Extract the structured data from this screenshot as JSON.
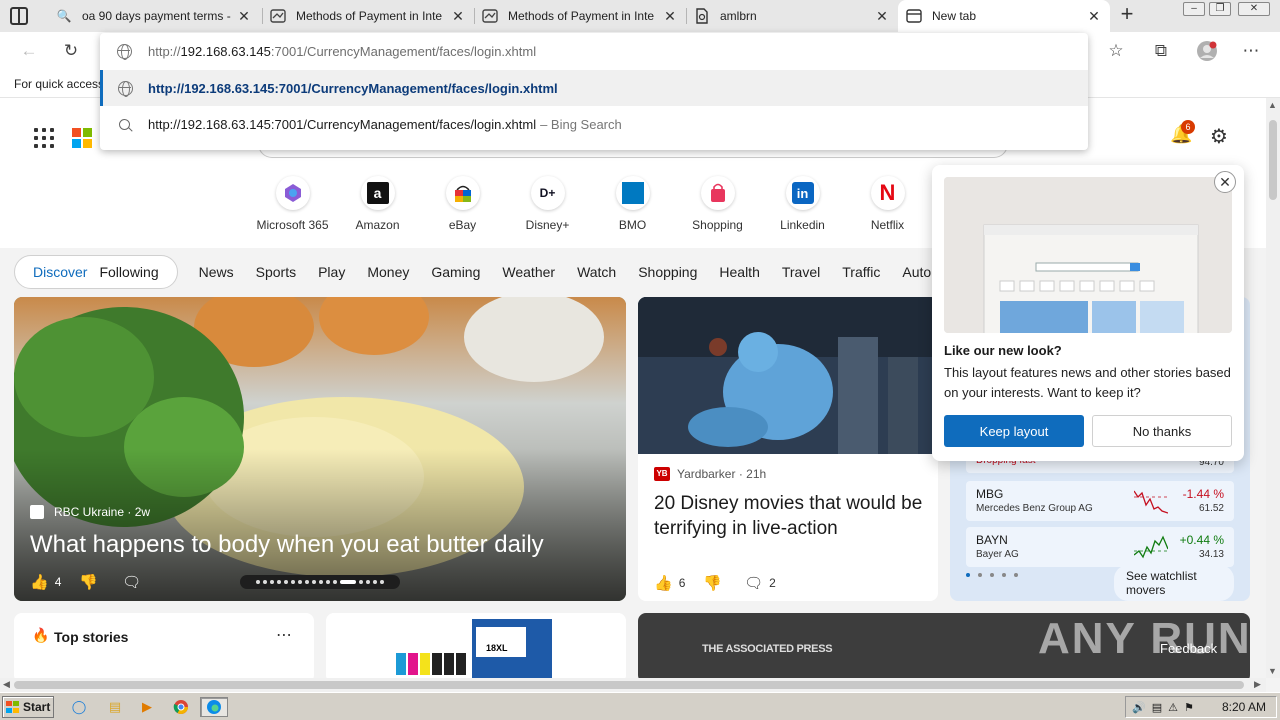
{
  "tabs": [
    {
      "title": "oa 90 days payment terms -",
      "icon": "search-icon"
    },
    {
      "title": "Methods of Payment in Inte",
      "icon": "page-icon"
    },
    {
      "title": "Methods of Payment in Inte",
      "icon": "page-icon"
    },
    {
      "title": "amlbrn",
      "icon": "page-icon"
    },
    {
      "title": "New tab",
      "icon": "newtab-icon"
    }
  ],
  "omnibox": {
    "input_prefix": "http://",
    "input_host": "192.168.63.145",
    "input_rest": ":7001/CurrencyManagement/faces/login.xhtml",
    "suggestion_url": "http://192.168.63.145:7001/CurrencyManagement/faces/login.xhtml",
    "search_text": "http://192.168.63.145:7001/CurrencyManagement/faces/login.xhtml",
    "search_suffix": "– Bing Search"
  },
  "favorites_hint": "For quick access",
  "notifications_count": "6",
  "quick_links": [
    "Microsoft 365",
    "Amazon",
    "eBay",
    "Disney+",
    "BMO",
    "Shopping",
    "Linkedin",
    "Netflix"
  ],
  "nav": {
    "discover": "Discover",
    "following": "Following",
    "items": [
      "News",
      "Sports",
      "Play",
      "Money",
      "Gaming",
      "Weather",
      "Watch",
      "Shopping",
      "Health",
      "Travel",
      "Traffic",
      "Auto"
    ]
  },
  "hero": {
    "source": "RBC Ukraine",
    "age": "2w",
    "title": "What happens to body when you eat butter daily",
    "likes": "4"
  },
  "card2": {
    "source": "Yardbarker",
    "age": "21h",
    "title": "20 Disney movies that would be terrifying in live-action",
    "likes": "6",
    "comments": "2"
  },
  "watchlist": {
    "partial_row": {
      "name": "Dropping fast",
      "price": "94.70"
    },
    "stocks": [
      {
        "symbol": "MBG",
        "name": "Mercedes Benz Group AG",
        "change": "-1.44 %",
        "price": "61.52"
      },
      {
        "symbol": "BAYN",
        "name": "Bayer AG",
        "change": "+0.44 %",
        "price": "34.13"
      }
    ],
    "see_movers": "See watchlist movers"
  },
  "top_stories": {
    "title": "Top stories"
  },
  "ap_label": "THE ASSOCIATED PRESS",
  "ad_label": "18XL",
  "watermark": "ANY RUN",
  "feedback": "Feedback",
  "popup": {
    "title": "Like our new look?",
    "body": "This layout features news and other stories based on your interests. Want to keep it?",
    "keep": "Keep layout",
    "no": "No thanks"
  },
  "taskbar": {
    "start": "Start",
    "clock": "8:20 AM"
  },
  "colors": {
    "accent": "#0f6cbd",
    "negative": "#c50f1f",
    "positive": "#107c10"
  }
}
